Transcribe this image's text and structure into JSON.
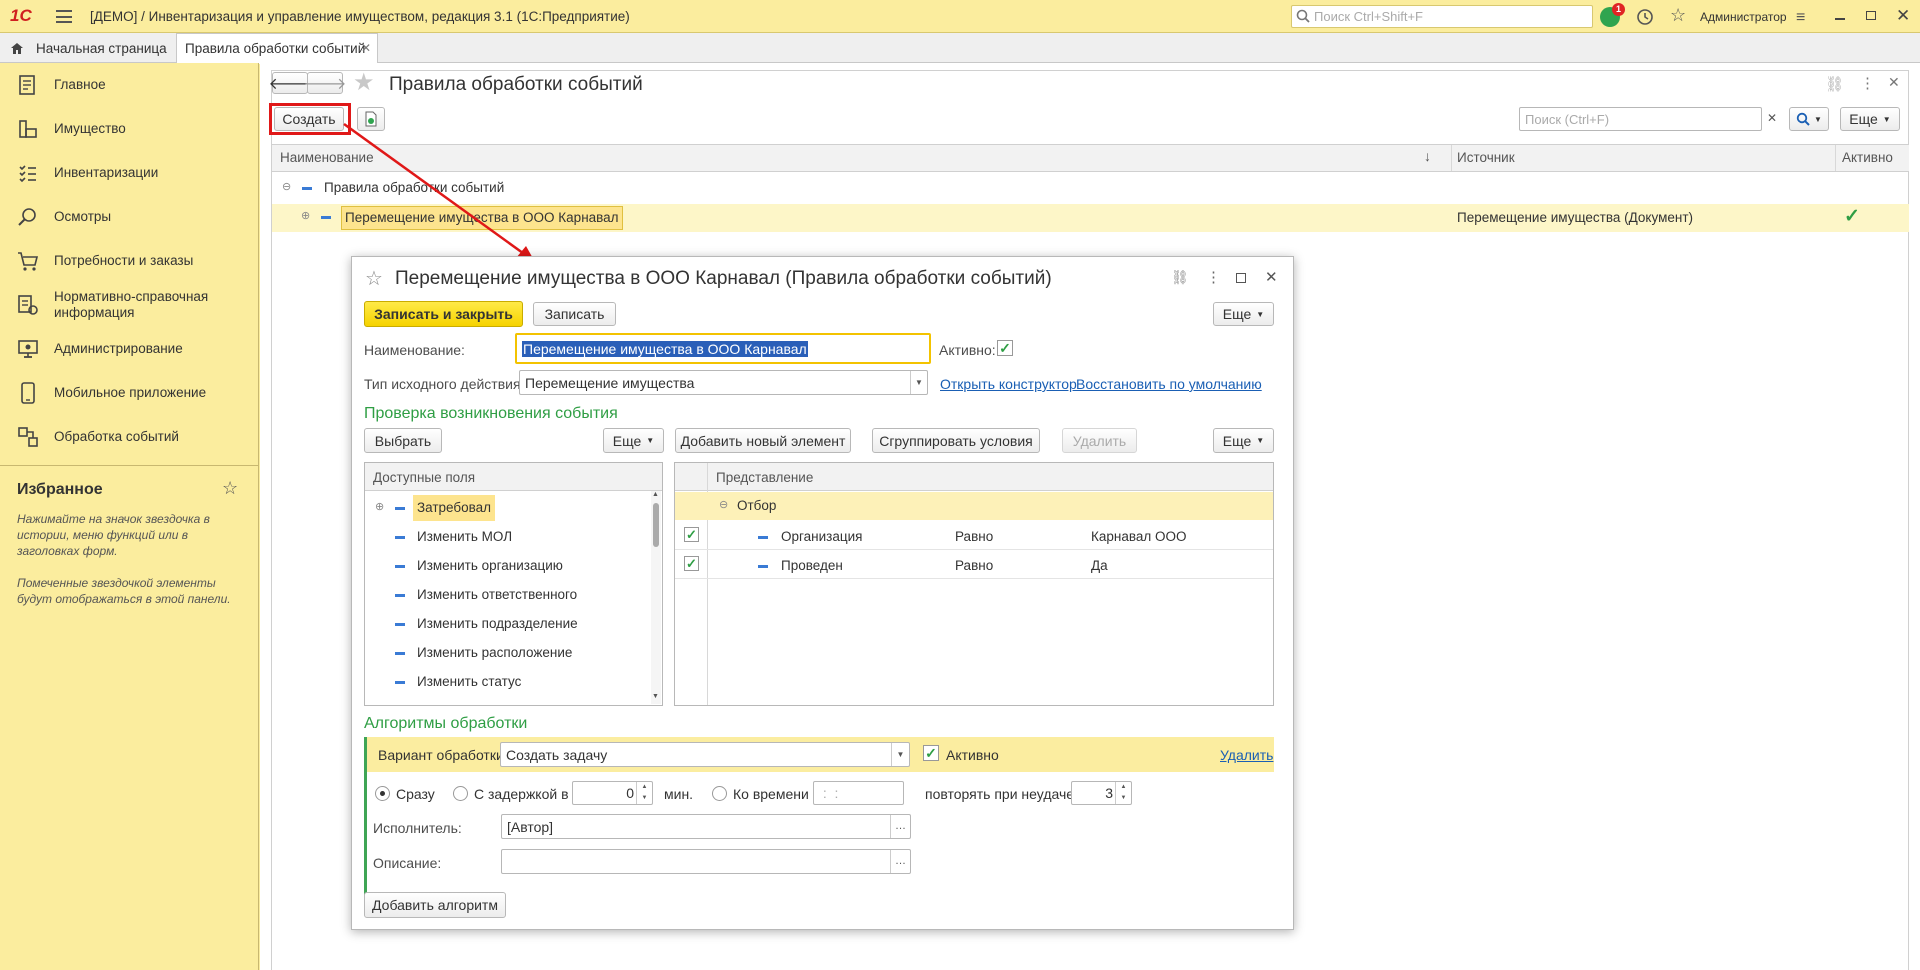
{
  "app": {
    "logo": "1С",
    "title": "[ДЕМО] / Инвентаризация и управление имуществом, редакция 3.1  (1С:Предприятие)",
    "search_placeholder": "Поиск Ctrl+Shift+F",
    "notifications": "1",
    "user": "Администратор"
  },
  "tabs": [
    {
      "label": "Начальная страница"
    },
    {
      "label": "Правила обработки событий"
    }
  ],
  "sidebar": {
    "items": [
      {
        "label": "Главное",
        "icon": "document-icon"
      },
      {
        "label": "Имущество",
        "icon": "inventory-icon"
      },
      {
        "label": "Инвентаризации",
        "icon": "checklist-icon"
      },
      {
        "label": "Осмотры",
        "icon": "magnifier-icon"
      },
      {
        "label": "Потребности и заказы",
        "icon": "cart-icon"
      },
      {
        "label": "Нормативно-справочная\nинформация",
        "icon": "reference-icon"
      },
      {
        "label": "Администрирование",
        "icon": "admin-icon"
      },
      {
        "label": "Мобильное приложение",
        "icon": "mobile-icon"
      },
      {
        "label": "Обработка событий",
        "icon": "events-icon"
      }
    ],
    "favorites_title": "Избранное",
    "favorites_hint1": "Нажимайте на значок звездочка в истории, меню функций или в заголовках форм.",
    "favorites_hint2": "Помеченные звездочкой элементы будут отображаться в этой панели."
  },
  "list": {
    "title": "Правила обработки событий",
    "create_label": "Создать",
    "search_placeholder": "Поиск (Ctrl+F)",
    "more_label": "Еще",
    "columns": [
      "Наименование",
      "Источник",
      "Активно"
    ],
    "group_row": "Правила обработки событий",
    "row": {
      "name": "Перемещение имущества в ООО Карнавал",
      "source": "Перемещение имущества (Документ)",
      "active": "✓"
    }
  },
  "form": {
    "title": "Перемещение имущества в ООО Карнавал (Правила обработки событий)",
    "save_close": "Записать и закрыть",
    "save": "Записать",
    "more": "Еще",
    "name_label": "Наименование:",
    "name_value": "Перемещение имущества в ООО Карнавал",
    "active_label": "Активно:",
    "action_label": "Тип исходного действия:",
    "action_value": "Перемещение имущества",
    "open_constructor": "Открыть конструктор",
    "restore_default": "Восстановить по умолчанию",
    "check_title": "Проверка возникновения события",
    "select_btn": "Выбрать",
    "more_btn": "Еще",
    "add_element": "Добавить новый элемент",
    "group_conditions": "Сгруппировать условия",
    "delete_btn": "Удалить",
    "fields_header": "Доступные поля",
    "fields": [
      "Затребовал",
      "Изменить МОЛ",
      "Изменить организацию",
      "Изменить ответственного",
      "Изменить подразделение",
      "Изменить расположение",
      "Изменить статус"
    ],
    "repr_header": "Представление",
    "filter_group": "Отбор",
    "conditions": [
      {
        "field": "Организация",
        "op": "Равно",
        "value": "Карнавал ООО"
      },
      {
        "field": "Проведен",
        "op": "Равно",
        "value": "Да"
      }
    ],
    "algo_title": "Алгоритмы обработки",
    "variant_label": "Вариант обработки:",
    "variant_value": "Создать задачу",
    "algo_active": "Активно",
    "algo_delete": "Удалить",
    "radio_now": "Сразу",
    "radio_delay": "С задержкой в",
    "delay_value": "0",
    "minutes": "мин.",
    "radio_time": "Ко времени",
    "time_value": " :  : ",
    "retry_label": "повторять при неудаче:",
    "retry_value": "3",
    "executor_label": "Исполнитель:",
    "executor_value": "[Автор]",
    "desc_label": "Описание:",
    "desc_value": "",
    "add_algo": "Добавить алгоритм"
  }
}
